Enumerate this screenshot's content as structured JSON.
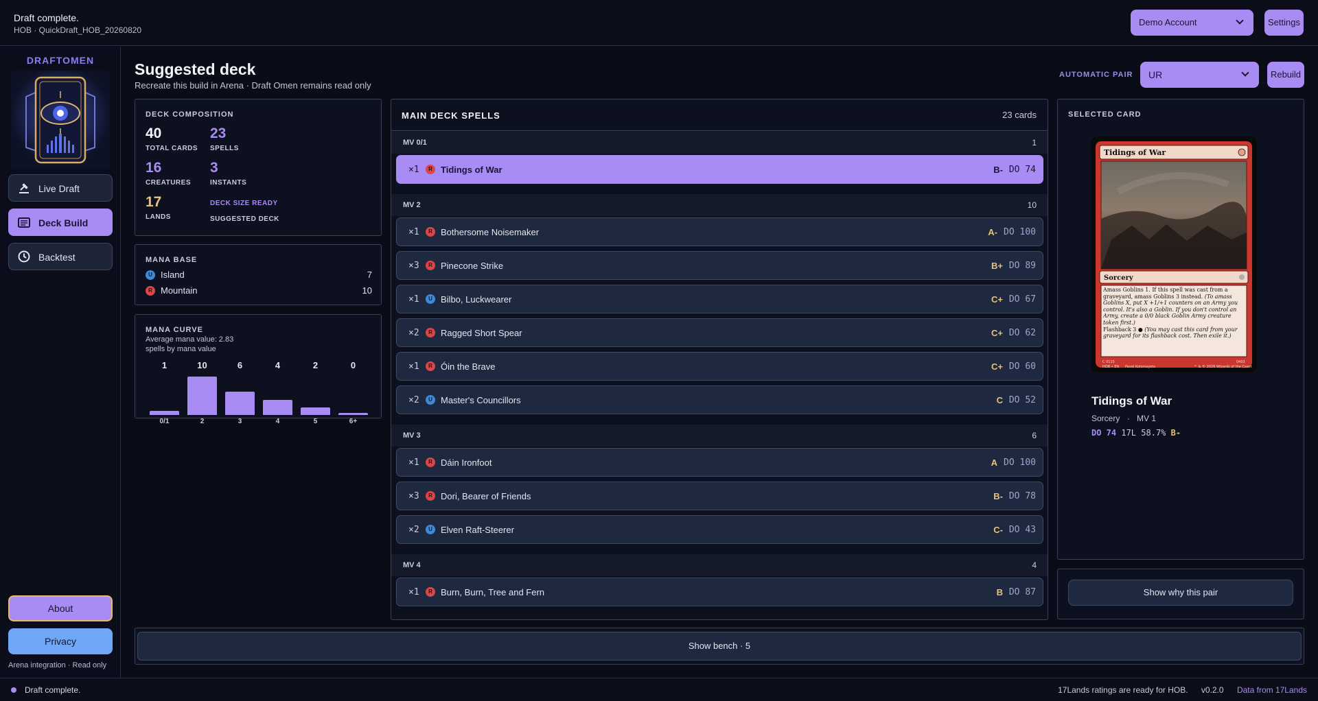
{
  "topbar": {
    "status_title": "Draft complete.",
    "status_sub": "HOB · QuickDraft_HOB_20260820",
    "account": "Demo Account",
    "settings_label": "Settings"
  },
  "sidebar": {
    "brand": "DRAFTOMEN",
    "logo_icon": "eye-logo-icon",
    "items": [
      {
        "label": "Live Draft",
        "icon": "gavel-icon",
        "active": false
      },
      {
        "label": "Deck Build",
        "icon": "deck-icon",
        "active": true
      },
      {
        "label": "Backtest",
        "icon": "history-icon",
        "active": false
      }
    ],
    "about_label": "About",
    "privacy_label": "Privacy",
    "footnote": "Arena integration · Read only"
  },
  "header": {
    "title": "Suggested deck",
    "subtitle": "Recreate this build in Arena · Draft Omen remains read only",
    "pair_label": "AUTOMATIC PAIR",
    "pair_value": "UR",
    "rebuild_label": "Rebuild"
  },
  "composition": {
    "label": "DECK COMPOSITION",
    "total": "40",
    "total_label": "TOTAL CARDS",
    "spells": "23",
    "spells_label": "SPELLS",
    "creatures": "16",
    "creatures_label": "CREATURES",
    "instants": "3",
    "instants_label": "INSTANTS",
    "lands": "17",
    "lands_label": "LANDS",
    "ready_label": "DECK SIZE READY",
    "suggested_label": "SUGGESTED DECK"
  },
  "mana_base": {
    "label": "MANA BASE",
    "rows": [
      {
        "color": "U",
        "name": "Island",
        "count": "7"
      },
      {
        "color": "R",
        "name": "Mountain",
        "count": "10"
      }
    ]
  },
  "mana_curve": {
    "label": "MANA CURVE",
    "average": "Average mana value: 2.83",
    "note": "spells by mana value"
  },
  "chart_data": {
    "type": "bar",
    "categories": [
      "0/1",
      "2",
      "3",
      "4",
      "5",
      "6+"
    ],
    "values": [
      1,
      10,
      6,
      4,
      2,
      0
    ],
    "ylim": [
      0,
      10
    ],
    "grid": false
  },
  "spells": {
    "title": "MAIN DECK SPELLS",
    "count": "23 cards",
    "groups": [
      {
        "name": "MV 0/1",
        "count": "1",
        "cards": [
          {
            "qty": "×1",
            "color": "R",
            "name": "Tidings of War",
            "grade": "B-",
            "do": "DO 74",
            "selected": true
          }
        ]
      },
      {
        "name": "MV 2",
        "count": "10",
        "cards": [
          {
            "qty": "×1",
            "color": "R",
            "name": "Bothersome Noisemaker",
            "grade": "A-",
            "do": "DO 100"
          },
          {
            "qty": "×3",
            "color": "R",
            "name": "Pinecone Strike",
            "grade": "B+",
            "do": "DO 89"
          },
          {
            "qty": "×1",
            "color": "U",
            "name": "Bilbo, Luckwearer",
            "grade": "C+",
            "do": "DO 67"
          },
          {
            "qty": "×2",
            "color": "R",
            "name": "Ragged Short Spear",
            "grade": "C+",
            "do": "DO 62"
          },
          {
            "qty": "×1",
            "color": "R",
            "name": "Óin the Brave",
            "grade": "C+",
            "do": "DO 60"
          },
          {
            "qty": "×2",
            "color": "U",
            "name": "Master's Councillors",
            "grade": "C",
            "do": "DO 52"
          }
        ]
      },
      {
        "name": "MV 3",
        "count": "6",
        "cards": [
          {
            "qty": "×1",
            "color": "R",
            "name": "Dáin Ironfoot",
            "grade": "A",
            "do": "DO 100"
          },
          {
            "qty": "×3",
            "color": "R",
            "name": "Dori, Bearer of Friends",
            "grade": "B-",
            "do": "DO 78"
          },
          {
            "qty": "×2",
            "color": "U",
            "name": "Elven Raft-Steerer",
            "grade": "C-",
            "do": "DO 43"
          }
        ]
      },
      {
        "name": "MV 4",
        "count": "4",
        "cards": [
          {
            "qty": "×1",
            "color": "R",
            "name": "Burn, Burn, Tree and Fern",
            "grade": "B",
            "do": "DO 87"
          }
        ]
      }
    ]
  },
  "selected_card": {
    "label": "SELECTED CARD",
    "name": "Tidings of War",
    "type": "Sorcery",
    "mv": "MV 1",
    "do": "DO 74",
    "record": "17L",
    "winrate": "58.7%",
    "grade": "B-",
    "card_face": {
      "type_line": "Sorcery",
      "rules_1": "Amass Goblins 1. If this spell was cast from a graveyard, amass Goblins 3 instead.",
      "reminder_1": "(To amass Goblins X, put X +1/+1 counters on an Army you control. It's also a Goblin. If you don't control an Army, create a 0/0 black Goblin Army creature token first.)",
      "rules_2": "Flashback 3",
      "reminder_2": "(You may cast this card from your graveyard for its flashback cost. Then exile it.)",
      "collector": "C 0115",
      "set_line": "HOB • EN",
      "artist": "Pavel Kolomeyets",
      "number": "0403",
      "copyright": "™ & © 2026 Wizards of the Coast"
    },
    "why_label": "Show why this pair"
  },
  "bench": {
    "label": "Show bench · 5"
  },
  "footer": {
    "status": "Draft complete.",
    "ratings": "17Lands ratings are ready for HOB.",
    "version": "v0.2.0",
    "data_link": "Data from 17Lands"
  },
  "colors": {
    "accent": "#a98cf3",
    "gold": "#e8c27a",
    "blue_pip": "#3d8ad8",
    "red_pip": "#d9474a"
  }
}
